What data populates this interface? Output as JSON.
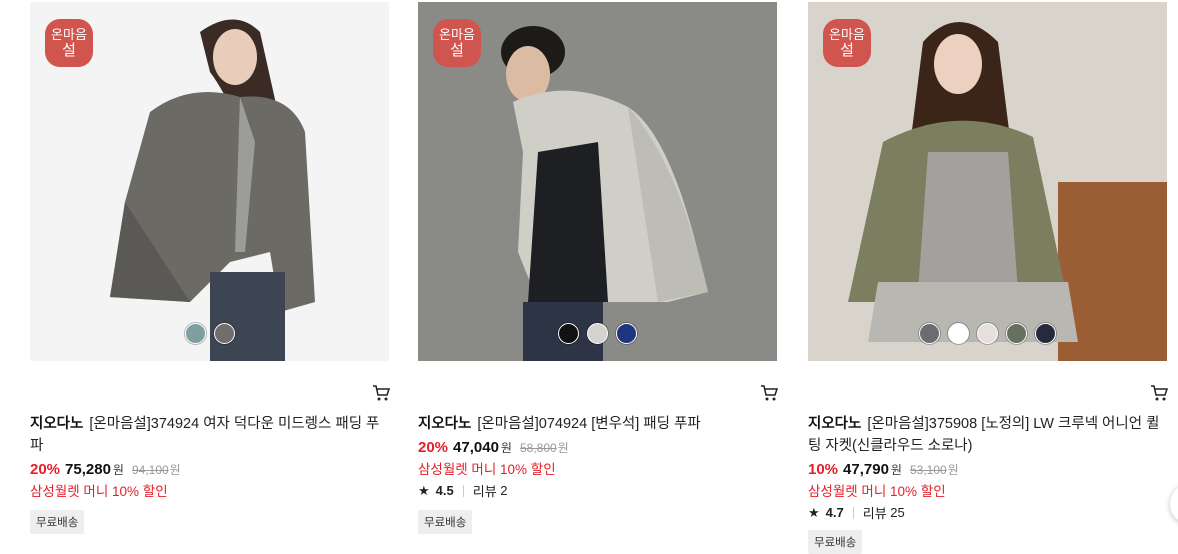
{
  "products": [
    {
      "badge": {
        "line1": "온마음",
        "line2": "설"
      },
      "brand": "지오다노",
      "name": "[온마음설]374924 여자 덕다운 미드렝스 패딩 푸파",
      "discount_rate": "20%",
      "price": "75,280",
      "price_unit": "원",
      "original_price": "94,100",
      "original_unit": "원",
      "promo": "삼성월렛 머니 10% 할인",
      "tag": "무료배송",
      "swatches": [
        "#7f9ea0",
        "#6f6e6c"
      ],
      "image_tone": {
        "bg": "#f4f4f4",
        "main": "#6b6a65"
      }
    },
    {
      "badge": {
        "line1": "온마음",
        "line2": "설"
      },
      "brand": "지오다노",
      "name": "[온마음설]074924 [변우석] 패딩 푸파",
      "discount_rate": "20%",
      "price": "47,040",
      "price_unit": "원",
      "original_price": "58,800",
      "original_unit": "원",
      "promo": "삼성월렛 머니 10% 할인",
      "rating": "4.5",
      "review_label": "리뷰",
      "review_count": "2",
      "tag": "무료배송",
      "swatches": [
        "#111111",
        "#d5d3cf",
        "#1e3580"
      ],
      "image_tone": {
        "bg": "#8a8b86",
        "main": "#cfcfc8"
      }
    },
    {
      "badge": {
        "line1": "온마음",
        "line2": "설"
      },
      "brand": "지오다노",
      "name": "[온마음설]375908 [노정의] LW 크루넥 어니언 퀼팅 자켓(신클라우드 소로나)",
      "discount_rate": "10%",
      "price": "47,790",
      "price_unit": "원",
      "original_price": "53,100",
      "original_unit": "원",
      "promo": "삼성월렛 머니 10% 할인",
      "rating": "4.7",
      "review_label": "리뷰",
      "review_count": "25",
      "tag": "무료배송",
      "swatches": [
        "#6c6c70",
        "#ffffff",
        "#e6dfdc",
        "#65705f",
        "#252b3c"
      ],
      "image_tone": {
        "bg": "#d9d4cb",
        "main": "#7b7f5f"
      }
    }
  ],
  "colors": {
    "accent_red": "#e4202a",
    "badge_red": "#d0554e"
  }
}
